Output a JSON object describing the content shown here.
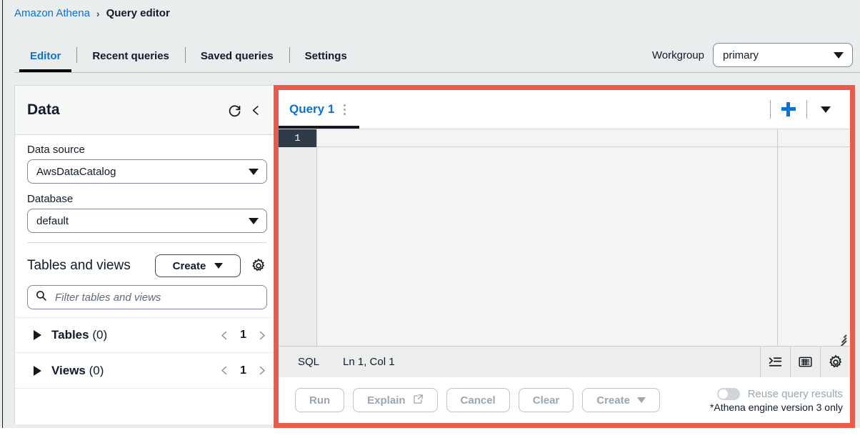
{
  "breadcrumb": {
    "root": "Amazon Athena",
    "separator": "›",
    "current": "Query editor"
  },
  "tabs": [
    {
      "label": "Editor",
      "active": true
    },
    {
      "label": "Recent queries",
      "active": false
    },
    {
      "label": "Saved queries",
      "active": false
    },
    {
      "label": "Settings",
      "active": false
    }
  ],
  "workgroup": {
    "label": "Workgroup",
    "value": "primary",
    "icon": "chevron-down-icon"
  },
  "sidebar": {
    "title": "Data",
    "refresh_icon": "refresh-icon",
    "collapse_icon": "chevron-left-icon",
    "data_source": {
      "label": "Data source",
      "value": "AwsDataCatalog"
    },
    "database": {
      "label": "Database",
      "value": "default"
    },
    "tables_and_views": {
      "title": "Tables and views",
      "create_label": "Create",
      "settings_icon": "gear-icon",
      "filter_placeholder": "Filter tables and views",
      "filter_value": "",
      "search_icon": "search-icon",
      "groups": [
        {
          "label": "Tables",
          "count": "(0)",
          "page": "1"
        },
        {
          "label": "Views",
          "count": "(0)",
          "page": "1"
        }
      ]
    }
  },
  "editor": {
    "query_tabs": [
      {
        "label": "Query 1",
        "active": true,
        "menu_icon": "kebab-menu-icon"
      }
    ],
    "add_tab_icon": "plus-icon",
    "tab_list_icon": "chevron-down-icon",
    "gutter_line": "1",
    "content": "",
    "resize_grip_icon": "resize-grip-icon",
    "status": {
      "language": "SQL",
      "cursor": "Ln 1, Col 1",
      "icons": [
        "format-indent-icon",
        "keyboard-shortcuts-icon",
        "editor-settings-gear-icon"
      ]
    },
    "actions": [
      {
        "label": "Run",
        "disabled": true,
        "icon": null
      },
      {
        "label": "Explain",
        "disabled": true,
        "icon": "external-link-icon"
      },
      {
        "label": "Cancel",
        "disabled": true,
        "icon": null
      },
      {
        "label": "Clear",
        "disabled": true,
        "icon": null
      },
      {
        "label": "Create",
        "disabled": true,
        "icon": "chevron-down-icon"
      }
    ],
    "reuse": {
      "label": "Reuse query results",
      "enabled": false,
      "note": "*Athena engine version 3 only"
    }
  },
  "colors": {
    "accent_link": "#0972d3",
    "highlight_frame": "#eb5b4b",
    "page_background": "#eaeded",
    "active_tab_underline": "#16191f"
  }
}
